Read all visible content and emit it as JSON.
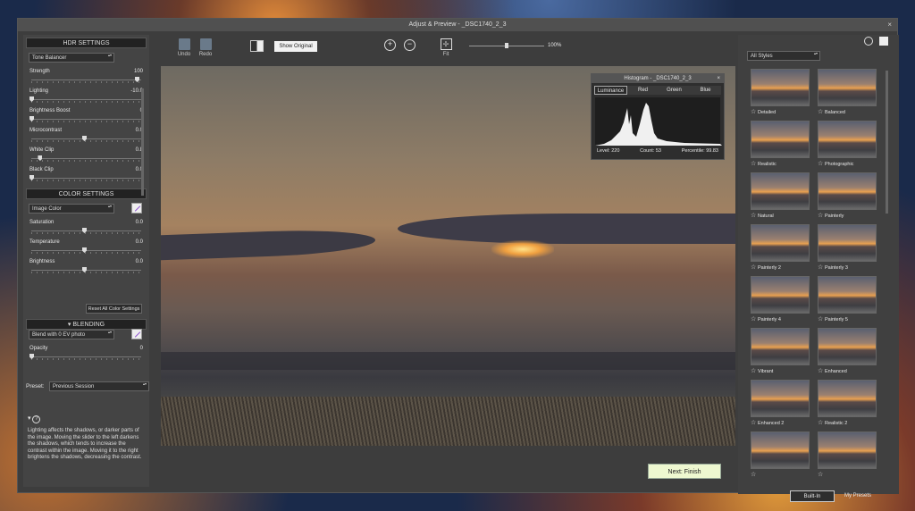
{
  "window": {
    "title": "Adjust & Preview - _DSC1740_2_3",
    "close": "×"
  },
  "hdr": {
    "heading": "HDR SETTINGS",
    "mode": "Tone Balancer",
    "sliders": [
      {
        "label": "Strength",
        "value": "100",
        "pos": 1.0
      },
      {
        "label": "Lighting",
        "value": "-10.0",
        "pos": 0.0
      },
      {
        "label": "Brightness Boost",
        "value": "0",
        "pos": 0.0
      },
      {
        "label": "Microcontrast",
        "value": "0.0",
        "pos": 0.5
      },
      {
        "label": "White Clip",
        "value": "0.8",
        "pos": 0.08
      },
      {
        "label": "Black Clip",
        "value": "0.0",
        "pos": 0.0
      }
    ]
  },
  "color": {
    "heading": "COLOR SETTINGS",
    "mode": "Image Color",
    "sliders": [
      {
        "label": "Saturation",
        "value": "0.0",
        "pos": 0.5
      },
      {
        "label": "Temperature",
        "value": "0.0",
        "pos": 0.5
      },
      {
        "label": "Brightness",
        "value": "0.0",
        "pos": 0.5
      }
    ],
    "reset": "Reset All Color Settings"
  },
  "blending": {
    "heading": "BLENDING",
    "mode": "Blend with 0 EV photo",
    "slider": {
      "label": "Opacity",
      "value": "0",
      "pos": 0.0
    }
  },
  "preset": {
    "label": "Preset:",
    "value": "Previous Session"
  },
  "help": {
    "text": "Lighting affects the shadows, or darker parts of the image. Moving the slider to the left darkens the shadows, which tends to increase the contrast within the image. Moving it to the right brightens the shadows, decreasing the contrast."
  },
  "toolbar": {
    "undo": "Undo",
    "redo": "Redo",
    "show_original": "Show Original",
    "fit": "Fit",
    "zoom": "100%",
    "zoom_level": 0.5
  },
  "histogram": {
    "title": "Histogram - _DSC1740_2_3",
    "close": "×",
    "tabs": [
      "Luminance",
      "Red",
      "Green",
      "Blue"
    ],
    "level": "Level: 220",
    "count": "Count: 53",
    "percentile": "Percentile: 99.83"
  },
  "styles": {
    "filter": "All Styles",
    "presets": [
      "Detailed",
      "Balanced",
      "Realistic",
      "Photographic",
      "Natural",
      "Painterly",
      "Painterly 2",
      "Painterly 3",
      "Painterly 4",
      "Painterly 5",
      "Vibrant",
      "Enhanced",
      "Enhanced 2",
      "Realistic 2",
      "",
      ""
    ],
    "tab_builtin": "Built-In",
    "tab_my": "My Presets"
  },
  "finish": "Next: Finish"
}
